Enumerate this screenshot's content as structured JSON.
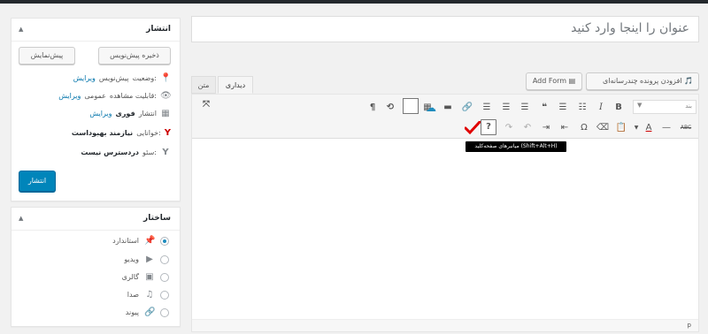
{
  "publish": {
    "title": "انتشار",
    "save_draft": "ذخیره پیش‌نویس",
    "preview": "پیش‌نمایش",
    "status_label": "وضعیت:",
    "status_value": "پیش‌نویس",
    "status_edit": "ویرایش",
    "visibility_label": "قابلیت مشاهده:",
    "visibility_value": "عمومی",
    "visibility_edit": "ویرایش",
    "publish_label": "انتشار",
    "publish_value": "فوری",
    "publish_edit": "ویرایش",
    "readability_label": "خوانایی:",
    "readability_value": "نیازمند بهبوداست",
    "seo_label": "سئو:",
    "seo_value": "دردسترس نیست",
    "publish_button": "انتشار"
  },
  "format": {
    "title": "ساختار",
    "options": [
      {
        "label": "استاندارد",
        "icon": "pin-icon",
        "checked": true
      },
      {
        "label": "ویدیو",
        "icon": "video-icon",
        "checked": false
      },
      {
        "label": "گالری",
        "icon": "gallery-icon",
        "checked": false
      },
      {
        "label": "صدا",
        "icon": "audio-icon",
        "checked": false
      },
      {
        "label": "پیوند",
        "icon": "link-icon",
        "checked": false
      }
    ]
  },
  "title_placeholder": "عنوان را اینجا وارد کنید",
  "media_button": "افزودن پرونده چندرسانه‌ای",
  "add_form_button": "Add Form",
  "tabs": {
    "visual": "دیداری",
    "text": "متن"
  },
  "toolbar": {
    "paragraph_select": "بند",
    "tooltip": "میانبرهای صفحه‌کلید (Shift+Alt+H)"
  },
  "status_path": "p",
  "colors": {
    "primary": "#0085ba",
    "link": "#0073aa",
    "yoast_red": "#cc0000",
    "check_red": "#e00000"
  }
}
